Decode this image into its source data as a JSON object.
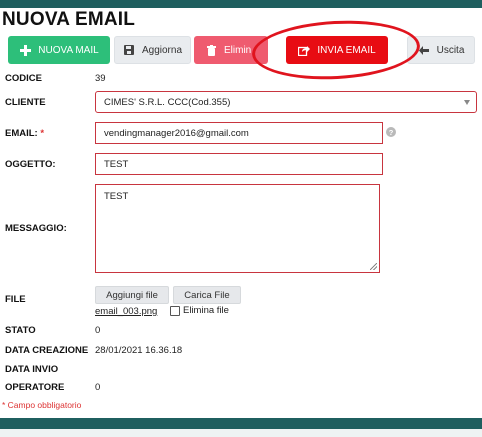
{
  "page": {
    "title": "NUOVA EMAIL"
  },
  "toolbar": {
    "nuova_label": "NUOVA MAIL",
    "aggiorna_label": "Aggiorna",
    "elimina_label": "Elimin",
    "invia_label": "INVIA EMAIL",
    "uscita_label": "Uscita",
    "colors": {
      "nuova": "#2dbf7a",
      "elimina": "#ef5b6f",
      "invia": "#e80c13",
      "annotation": "#e0141e"
    }
  },
  "icons": {
    "nuova": "plus-icon",
    "aggiorna": "floppy-disk-icon",
    "elimina": "trash-icon",
    "invia": "share-icon",
    "uscita": "arrow-left-icon",
    "help": "question-icon"
  },
  "form": {
    "codice": {
      "label": "CODICE",
      "value": "39"
    },
    "cliente": {
      "label": "CLIENTE",
      "value": "CIMES' S.R.L. CCC(Cod.355)"
    },
    "email": {
      "label": "EMAIL:",
      "required_mark": "*",
      "value": "vendingmanager2016@gmail.com",
      "help": "?"
    },
    "oggetto": {
      "label": "OGGETTO:",
      "value": "TEST"
    },
    "messaggio": {
      "label": "MESSAGGIO:",
      "value": "TEST"
    },
    "file": {
      "label": "FILE",
      "aggiungi_label": "Aggiungi file",
      "carica_label": "Carica File",
      "filename": "email_003.png",
      "elimina_label": "Elimina file"
    },
    "stato": {
      "label": "STATO",
      "value": "0"
    },
    "data_creazione": {
      "label": "DATA CREAZIONE",
      "value": "28/01/2021 16.36.18"
    },
    "data_invio": {
      "label": "DATA INVIO",
      "value": ""
    },
    "operatore": {
      "label": "OPERATORE",
      "value": "0"
    }
  },
  "note": "* Campo obbligatorio"
}
